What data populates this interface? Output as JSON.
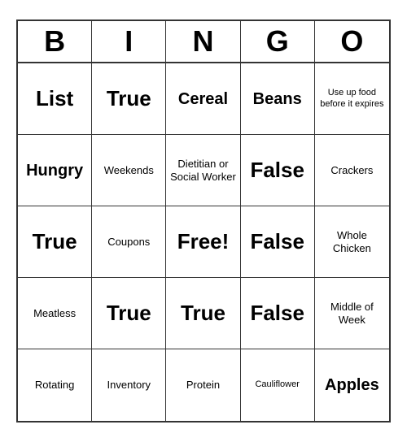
{
  "header": {
    "letters": [
      "B",
      "I",
      "N",
      "G",
      "O"
    ]
  },
  "cells": [
    {
      "text": "List",
      "size": "large"
    },
    {
      "text": "True",
      "size": "large"
    },
    {
      "text": "Cereal",
      "size": "medium"
    },
    {
      "text": "Beans",
      "size": "medium"
    },
    {
      "text": "Use up food before it expires",
      "size": "xsmall"
    },
    {
      "text": "Hungry",
      "size": "medium"
    },
    {
      "text": "Weekends",
      "size": "small"
    },
    {
      "text": "Dietitian or Social Worker",
      "size": "small"
    },
    {
      "text": "False",
      "size": "large"
    },
    {
      "text": "Crackers",
      "size": "small"
    },
    {
      "text": "True",
      "size": "large"
    },
    {
      "text": "Coupons",
      "size": "small"
    },
    {
      "text": "Free!",
      "size": "large"
    },
    {
      "text": "False",
      "size": "large"
    },
    {
      "text": "Whole Chicken",
      "size": "small"
    },
    {
      "text": "Meatless",
      "size": "small"
    },
    {
      "text": "True",
      "size": "large"
    },
    {
      "text": "True",
      "size": "large"
    },
    {
      "text": "False",
      "size": "large"
    },
    {
      "text": "Middle of Week",
      "size": "small"
    },
    {
      "text": "Rotating",
      "size": "small"
    },
    {
      "text": "Inventory",
      "size": "small"
    },
    {
      "text": "Protein",
      "size": "small"
    },
    {
      "text": "Cauliflower",
      "size": "xsmall"
    },
    {
      "text": "Apples",
      "size": "medium"
    }
  ]
}
